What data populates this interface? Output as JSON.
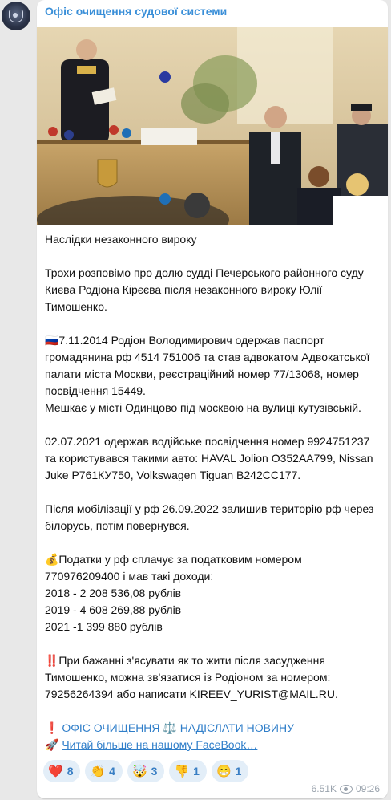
{
  "channel": {
    "name": "Офіс очищення судової системи"
  },
  "post": {
    "lines": [
      "Наслідки незаконного вироку",
      "",
      "Трохи розповімо про долю судді Печерського районного суду",
      "Києва Родіона Кірєєва після незаконного вироку Юлії",
      "Тимошенко.",
      "",
      "🇷🇺7.11.2014 Родіон Володимирович одержав паспорт",
      "громадянина рф 4514 751006 та став адвокатом Адвокатської",
      "палати міста Москви, реєстраційний номер 77/13068, номер",
      "посвідчення 15449.",
      "Мешкає у місті Одинцово під москвою на вулиці кутузівській.",
      "",
      "02.07.2021 одержав водійське посвідчення номер 9924751237",
      "та користувався такими авто: HAVAL Jolion О352АА799, Nissan",
      "Juke Р761КУ750, Volkswagen Tiguan В242СС177.",
      "",
      "Після мобілізації у рф 26.09.2022 залишив територію рф через",
      "білорусь, потім повернувся.",
      "",
      "💰Податки у рф сплачує за податковим номером",
      "770976209400 і мав такі доходи:",
      "2018 - 2 208 536,08 рублів",
      "2019 - 4 608 269,88 рублів",
      "2021 -1 399 880 рублів",
      "",
      "‼️При бажанні з'ясувати як то жити після засудження",
      "Тимошенко, можна зв'язатися із Родіоном за номером:",
      "79256264394 або написати KIREEV_YURIST@MAIL.RU.",
      ""
    ],
    "link1_prefix": "❗ ",
    "link1_text": "ОФІС ОЧИЩЕННЯ ⚖️ НАДІСЛАТИ НОВИНУ",
    "link2_prefix": "🚀 ",
    "link2_text": "Читай більше на нашому FaceBook…"
  },
  "reactions": [
    {
      "emoji": "❤️",
      "count": "8"
    },
    {
      "emoji": "👏",
      "count": "4"
    },
    {
      "emoji": "🤯",
      "count": "3"
    },
    {
      "emoji": "👎",
      "count": "1"
    },
    {
      "emoji": "😁",
      "count": "1"
    }
  ],
  "meta": {
    "views": "6.51K",
    "time": "09:26"
  },
  "colors": {
    "accent": "#3a8fd8",
    "link": "#2f7ec9",
    "reaction_bg": "#e3eef8"
  }
}
